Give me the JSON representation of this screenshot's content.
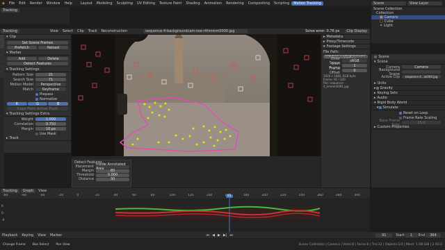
{
  "topbar": {
    "menus": [
      "File",
      "Edit",
      "Render",
      "Window",
      "Help"
    ],
    "workspaces": [
      "Layout",
      "Modeling",
      "Sculpting",
      "UV Editing",
      "Texture Paint",
      "Shading",
      "Animation",
      "Rendering",
      "Compositing",
      "Scripting",
      "Motion Tracking"
    ],
    "active_workspace": "Motion Tracking",
    "scene_label": "Scene",
    "view_layer_label": "View Layer"
  },
  "title": "Blender* [C:\\video\\venice tutorial\\venice tutorial.blend]",
  "clip_editor": {
    "mode": "Tracking",
    "clip_menu": [
      "View",
      "Select",
      "Clip",
      "Track",
      "Reconstruction"
    ],
    "clip_name": "sequence-4-backgroundcam-vse-r4hmmm0000.jpg",
    "solve_error": "Solve error: 0.76 px",
    "clip_display": "Clip Display"
  },
  "tool_panel": {
    "clip_title": "Clip",
    "set_scene_frames": "Set Scene Frames",
    "prefetch": "Prefetch",
    "reload": "Reload",
    "marker_title": "Marker",
    "add": "Add",
    "delete": "Delete",
    "detect_features": "Detect Features",
    "tracking_settings_title": "Tracking Settings",
    "pattern_size_label": "Pattern Size",
    "pattern_size": "21",
    "search_size_label": "Search Size",
    "search_size": "71",
    "motion_model_label": "Motion Model",
    "motion_model": "Perspective",
    "match_label": "Match",
    "match": "Keyframe",
    "prepass": "Prepass",
    "normalize": "Normalize",
    "channels": [
      "R",
      "G",
      "B"
    ],
    "copy_from_active": "Copy From Active Track",
    "tracking_extra_title": "Tracking Settings Extra",
    "weight_label": "Weight",
    "weight": "1.000",
    "correlation_label": "Correlation",
    "correlation": "0.750",
    "margin_label": "Margin",
    "margin": "10 px",
    "use_mask": "Use Mask",
    "track_title": "Track"
  },
  "detect_popup": {
    "title": "Detect Features",
    "placement_label": "Placement",
    "placement": "Inside Annotated Area",
    "margin_label": "Margin",
    "margin": "80",
    "threshold_label": "Threshold",
    "threshold": "0.000",
    "distance_label": "Distance",
    "distance": "30"
  },
  "right_panel": {
    "metadata": "Metadata",
    "proxy_timecode": "Proxy/Timecode",
    "footage_settings": "Footage Settings",
    "file_path_label": "File Path:",
    "file_path": "\\sequence-4-backgroundcam-vse-r4hmmm0000.jpg",
    "color_space_label": "Color Space",
    "color_space": "sRGB",
    "start_frame_label": "Start Frame",
    "start_frame": "1",
    "frame_offset_label": "Frame Offset",
    "frame_offset": "0",
    "info": [
      "1920 x 1080, RGB byte",
      "Frame: 91 / 320",
      "File: sequence-4_hmmm0091.jpg"
    ]
  },
  "outliner": {
    "items": [
      {
        "label": "Scene Collection",
        "selected": false
      },
      {
        "label": "Collection",
        "selected": false
      },
      {
        "label": "Camera",
        "selected": true
      },
      {
        "label": "Cube",
        "selected": false
      },
      {
        "label": "Light",
        "selected": false
      }
    ]
  },
  "properties": {
    "tab": "Scene",
    "section_scene": "Scene",
    "camera_label": "Camera",
    "camera": "Camera",
    "background_label": "Background Scene",
    "active_clip_label": "Active Clip",
    "active_clip": "sequence-4...ok000.jpg",
    "sections": [
      "Units",
      "Gravity",
      "Keying Sets",
      "Audio",
      "Rigid Body World",
      "Simulate",
      "Custom Properties"
    ],
    "gravity_checked": true,
    "rigid_checked": true,
    "reset_on_loop": "Reset on Loop",
    "frame_rate_scaling": "Frame Rate Scaling",
    "base_frame_rate_label": "Base Frame Rate",
    "base_frame_rate": "25.0"
  },
  "graph": {
    "mode": "Tracking",
    "view_type": "Graph",
    "menu": [
      "View"
    ],
    "ticks": [
      "-80",
      "-60",
      "-40",
      "-20",
      "0",
      "20",
      "40",
      "60",
      "80",
      "100",
      "120",
      "140",
      "160",
      "180",
      "200",
      "220",
      "240",
      "260",
      "280",
      "300"
    ],
    "current_frame": "91",
    "y_ticks": [
      "6",
      "0",
      "-6"
    ]
  },
  "timeline": {
    "menus": [
      "Playback",
      "Keying",
      "View",
      "Marker"
    ],
    "start_label": "Start",
    "start": "1",
    "end_label": "End",
    "end": "364",
    "frame": "91"
  },
  "status": {
    "left": [
      "Change Frame",
      "Box Select",
      "Pan View"
    ],
    "right": "Scene Collection | Camera | Verts:8 | Faces:6 | Tris:12 | Objects:1/3 | Mem: 1.08 GiB | 2.92.0"
  },
  "colors": {
    "accent": "#4a72b4",
    "marker_yellow": "#e8e600",
    "annotation_pink": "#e04fb0",
    "graph_red": "#d03030",
    "graph_green": "#40c040"
  }
}
